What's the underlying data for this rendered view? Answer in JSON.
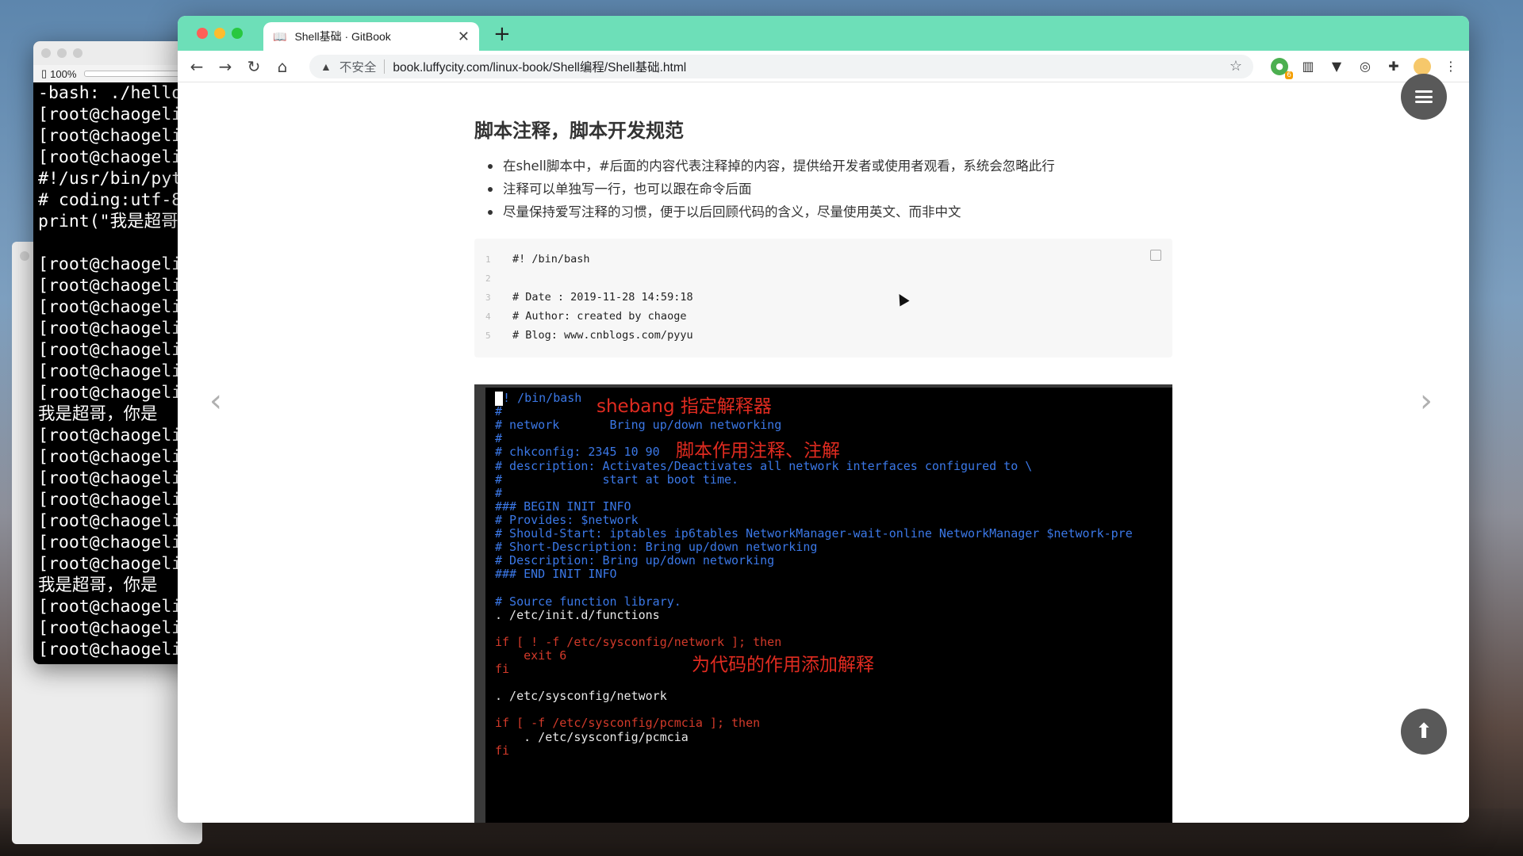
{
  "terminal": {
    "zoom": "100%",
    "lines": [
      "-bash: ./hello",
      "[root@chaogeli",
      "[root@chaogeli",
      "[root@chaogeli",
      "#!/usr/bin/pyt",
      "# coding:utf-8",
      "print(\"我是超哥",
      "",
      "[root@chaogeli",
      "[root@chaogeli",
      "[root@chaogeli",
      "[root@chaogeli",
      "[root@chaogeli",
      "[root@chaogeli",
      "[root@chaogeli",
      "我是超哥，你是",
      "[root@chaogeli",
      "[root@chaogeli",
      "[root@chaogeli",
      "[root@chaogeli",
      "[root@chaogeli",
      "[root@chaogeli",
      "[root@chaogeli",
      "我是超哥，你是",
      "[root@chaogeli",
      "[root@chaogeli",
      "[root@chaogeli"
    ]
  },
  "browser": {
    "tab_title": "Shell基础 · GitBook",
    "new_tab": "+",
    "insecure_label": "不安全",
    "url": "book.luffycity.com/linux-book/Shell编程/Shell基础.html"
  },
  "page": {
    "title": "脚本注释，脚本开发规范",
    "bullets": [
      "在shell脚本中，#后面的内容代表注释掉的内容，提供给开发者或使用者观看，系统会忽略此行",
      "注释可以单独写一行，也可以跟在命令后面",
      "尽量保持爱写注释的习惯，便于以后回顾代码的含义，尽量使用英文、而非中文"
    ],
    "code": [
      {
        "n": "1",
        "text": "#! /bin/bash"
      },
      {
        "n": "2",
        "text": ""
      },
      {
        "n": "3",
        "text": "# Date : 2019-11-28 14:59:18"
      },
      {
        "n": "4",
        "text": "# Author: created by chaoge"
      },
      {
        "n": "5",
        "text": "# Blog: www.cnblogs.com/pyyu"
      }
    ],
    "screenshot": {
      "annotations": [
        "shebang 指定解释器",
        "脚本作用注释、注解",
        "为代码的作用添加解释"
      ],
      "lines": [
        "! /bin/bash",
        "#",
        "# network       Bring up/down networking",
        "#",
        "# chkconfig: 2345 10 90",
        "# description: Activates/Deactivates all network interfaces configured to \\",
        "#              start at boot time.",
        "#",
        "### BEGIN INIT INFO",
        "# Provides: $network",
        "# Should-Start: iptables ip6tables NetworkManager-wait-online NetworkManager $network-pre",
        "# Short-Description: Bring up/down networking",
        "# Description: Bring up/down networking",
        "### END INIT INFO",
        "",
        "# Source function library.",
        ". /etc/init.d/functions",
        "",
        "if [ ! -f /etc/sysconfig/network ]; then",
        "    exit 6",
        "fi",
        "",
        ". /etc/sysconfig/network",
        "",
        "if [ -f /etc/sysconfig/pcmcia ]; then",
        "    . /etc/sysconfig/pcmcia",
        "fi"
      ]
    }
  },
  "icons": {
    "back": "arrow-left-icon",
    "forward": "arrow-right-icon",
    "reload": "reload-icon",
    "home": "home-icon",
    "menu": "hamburger-icon",
    "top": "arrow-up-icon"
  },
  "colors": {
    "tab_strip": "#6ddfb8",
    "annotation": "#e02b20",
    "fab": "#595959"
  }
}
